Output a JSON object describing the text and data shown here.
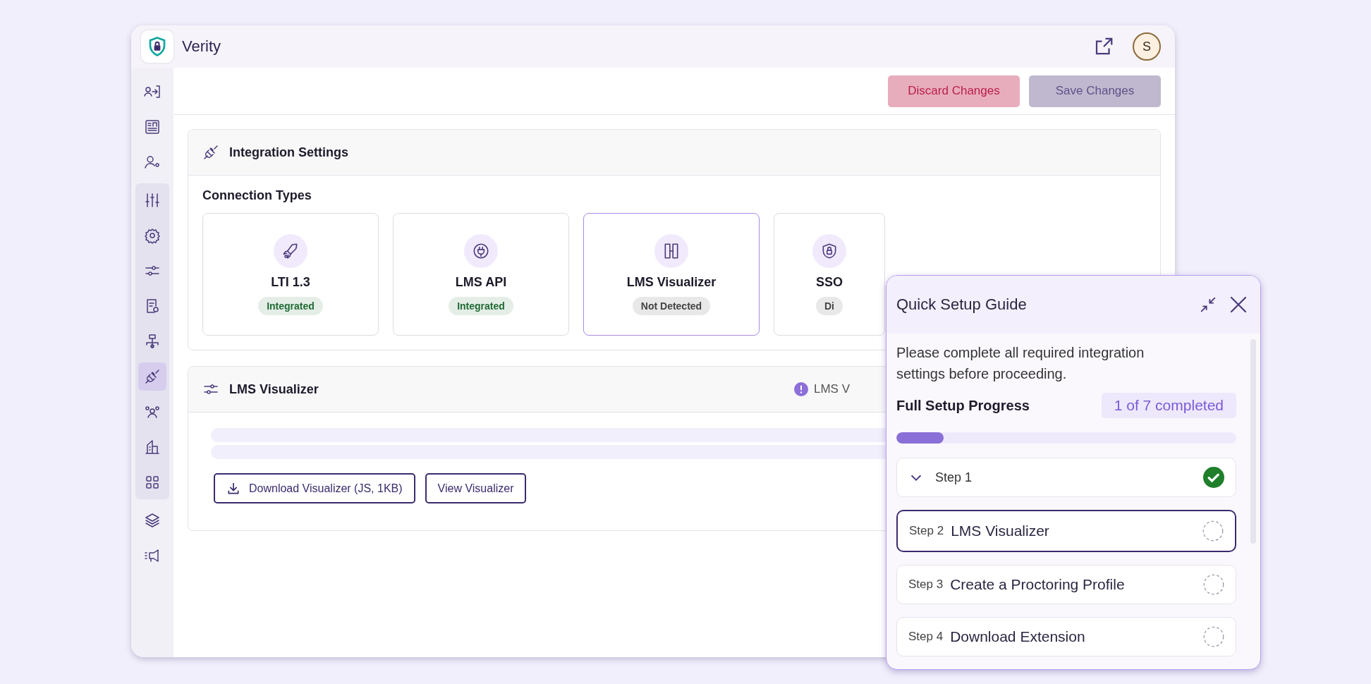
{
  "app": {
    "name": "Verity",
    "avatar_initial": "S"
  },
  "sidebar": {
    "top": [
      {
        "selected": false
      },
      {
        "selected": false
      },
      {
        "selected": false
      }
    ],
    "group": [
      {
        "selected": false
      },
      {
        "selected": false
      },
      {
        "selected": false
      },
      {
        "selected": false
      },
      {
        "selected": false
      },
      {
        "selected": true
      },
      {
        "selected": false
      },
      {
        "selected": false
      },
      {
        "selected": false
      }
    ],
    "bottom": [
      {
        "selected": false
      },
      {
        "selected": false
      }
    ]
  },
  "toolbar": {
    "buttons": [
      {
        "label": "Discard Changes",
        "kind": "danger",
        "disabled": false
      },
      {
        "label": "Save Changes",
        "kind": "primary",
        "disabled": true
      }
    ]
  },
  "integration": {
    "title": "Integration Settings",
    "subtitle": "Connection Types",
    "connections": [
      {
        "name": "LTI 1.3",
        "status": "Integrated",
        "color": "#1f6b34",
        "selected": false
      },
      {
        "name": "LMS API",
        "status": "Integrated",
        "color": "#1f6b34",
        "selected": false
      },
      {
        "name": "LMS Visualizer",
        "status": "Not Detected",
        "color": "#444444",
        "selected": true
      },
      {
        "name": "SSO",
        "status": "Di",
        "color": "#444444",
        "selected": false
      }
    ]
  },
  "visualizer": {
    "title": "LMS Visualizer",
    "notice": "LMS V",
    "buttons": [
      {
        "label": "Download Visualizer (JS, 1KB)",
        "kind": "download"
      },
      {
        "label": "View Visualizer",
        "kind": "plain"
      }
    ]
  },
  "guide": {
    "title": "Quick Setup Guide",
    "message": "Please complete all required integration settings before proceeding.",
    "progress_label": "Full Setup Progress",
    "progress_count": "1 of 7 completed",
    "level": 0.14,
    "steps": [
      {
        "kind": "group",
        "label": "Step 1",
        "completed": true,
        "selected": false
      },
      {
        "kind": "step",
        "label": "Step 2",
        "title": "LMS Visualizer",
        "completed": false,
        "selected": true
      },
      {
        "kind": "step",
        "label": "Step 3",
        "title": "Create a Proctoring Profile",
        "completed": false,
        "selected": false
      },
      {
        "kind": "step",
        "label": "Step 4",
        "title": "Download Extension",
        "completed": false,
        "selected": false
      }
    ]
  }
}
